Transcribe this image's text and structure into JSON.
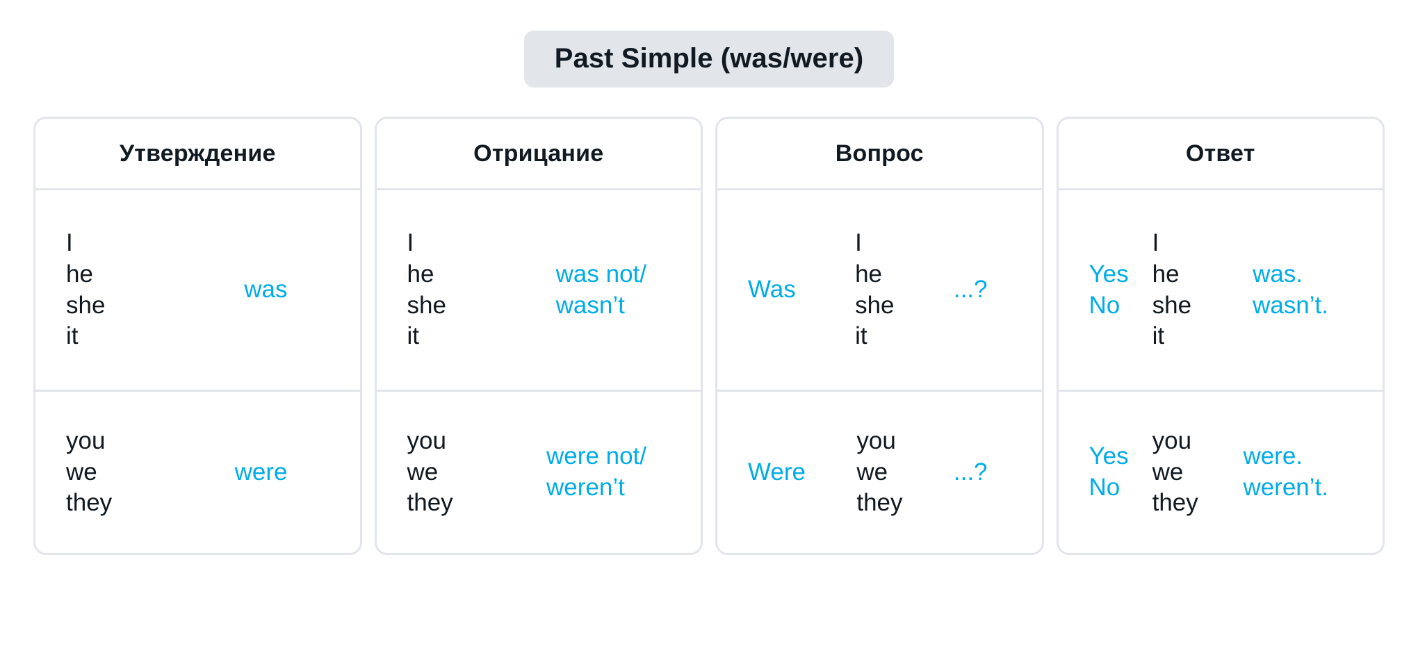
{
  "title": "Past Simple (was/were)",
  "columns": [
    {
      "key": "affirmative",
      "header": "Утверждение",
      "rows": [
        {
          "pronouns": [
            "I",
            "he",
            "she",
            "it"
          ],
          "verb": [
            "was"
          ]
        },
        {
          "pronouns": [
            "you",
            "we",
            "they"
          ],
          "verb": [
            "were"
          ]
        }
      ]
    },
    {
      "key": "negative",
      "header": "Отрицание",
      "rows": [
        {
          "pronouns": [
            "I",
            "he",
            "she",
            "it"
          ],
          "verb": [
            "was not/",
            "wasn’t"
          ]
        },
        {
          "pronouns": [
            "you",
            "we",
            "they"
          ],
          "verb": [
            "were not/",
            "weren’t"
          ]
        }
      ]
    },
    {
      "key": "question",
      "header": "Вопрос",
      "rows": [
        {
          "aux": [
            "Was"
          ],
          "pronouns": [
            "I",
            "he",
            "she",
            "it"
          ],
          "tail": [
            "...?"
          ]
        },
        {
          "aux": [
            "Were"
          ],
          "pronouns": [
            "you",
            "we",
            "they"
          ],
          "tail": [
            "...?"
          ]
        }
      ]
    },
    {
      "key": "answer",
      "header": "Ответ",
      "rows": [
        {
          "yesno": [
            "Yes",
            "No"
          ],
          "pronouns": [
            "I",
            "he",
            "she",
            "it"
          ],
          "verb": [
            "was.",
            "wasn’t."
          ]
        },
        {
          "yesno": [
            "Yes",
            "No"
          ],
          "pronouns": [
            "you",
            "we",
            "they"
          ],
          "verb": [
            "were.",
            "weren’t."
          ]
        }
      ]
    }
  ],
  "colors": {
    "accent": "#00ace8",
    "text": "#101820",
    "border": "#e2e5ea",
    "badge_bg": "#e2e6ea",
    "background": "#ffffff"
  }
}
